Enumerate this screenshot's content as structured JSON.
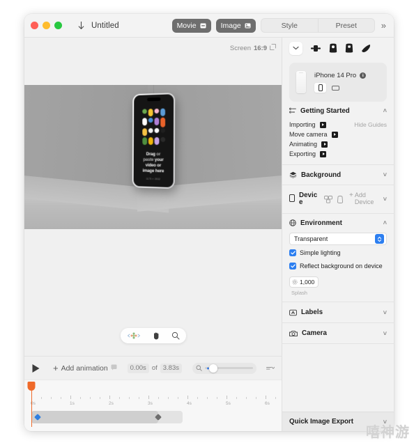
{
  "window": {
    "title": "Untitled",
    "download_icon": "download-arrow-icon",
    "traffic_lights": [
      "close",
      "minimize",
      "zoom"
    ]
  },
  "toolbar": {
    "movie_label": "Movie",
    "image_label": "Image",
    "style_label": "Style",
    "preset_label": "Preset",
    "overflow_label": "»"
  },
  "canvas": {
    "screen_prefix": "Screen",
    "screen_ratio": "16:9",
    "aspect_icon": "aspect-ratio-icon",
    "chevron_icon": "chevron-down-icon",
    "tools": [
      "move-axis-icon",
      "hand-tool-icon",
      "zoom-tool-icon"
    ],
    "phone": {
      "drop_line1_strong": "Drag",
      "drop_line1_dim": " or",
      "drop_line2_dim": "paste ",
      "drop_line2_strong": "your",
      "drop_line3": "video or",
      "drop_line4": "image here",
      "drop_sub": "1170 × 2532",
      "pill_colors": [
        "#6aa84f",
        "#f4c430",
        "#f7b7cf",
        "#5b9bd5",
        "#ffffff",
        "#4a90d9",
        "#b07fd6",
        "#f6c244",
        "#f2b705",
        "#e8e8e8",
        "#f0f0f0",
        "#e8622a",
        "#4f8f3f",
        "#efb40d",
        "#c5a3e8",
        "#2a2a2a"
      ]
    }
  },
  "transport": {
    "play_icon": "play-icon",
    "add_animation_label": "Add animation",
    "add_animation_badge_icon": "hint-badge-icon",
    "current_time": "0.00s",
    "of_label": "of",
    "total_time": "3.83s",
    "zoom_icon": "magnifier-icon",
    "fit_icon": "fit-timeline-icon"
  },
  "timeline": {
    "tick_labels": [
      "0s",
      "1s",
      "2s",
      "3s",
      "4s",
      "5s",
      "6s"
    ],
    "keyframes": [
      {
        "name": "start-keyframe",
        "color": "#2f7fe0"
      },
      {
        "name": "end-keyframe",
        "color": "#6d6d6d"
      }
    ]
  },
  "inspector": {
    "toolbar_icons": [
      "presets-chevron-icon",
      "camera-rig-icon",
      "device-front-icon",
      "device-back-icon",
      "device-angle-icon"
    ],
    "device_card": {
      "name": "iPhone 14 Pro",
      "info_badge": "i",
      "portrait_icon": "portrait-orientation-icon",
      "landscape_icon": "landscape-orientation-icon"
    },
    "sections": {
      "getting_started": {
        "title": "Getting Started",
        "icon": "checklist-icon",
        "caret": "˄",
        "hide_guides_label": "Hide Guides",
        "items": [
          {
            "label": "Importing"
          },
          {
            "label": "Move camera"
          },
          {
            "label": "Animating"
          },
          {
            "label": "Exporting"
          }
        ]
      },
      "background": {
        "title": "Background",
        "icon": "layers-icon",
        "caret": "˅"
      },
      "device": {
        "title": "Device",
        "icon": "phone-icon",
        "duplicate_icon": "duplicate-device-icon",
        "copy_icon": "copy-device-icon",
        "add_plus": "+",
        "add_label": "Add Device",
        "caret": "˅"
      },
      "environment": {
        "title": "Environment",
        "icon": "globe-icon",
        "caret": "˄",
        "preset_value": "Transparent",
        "simple_lighting_label": "Simple lighting",
        "simple_lighting_checked": true,
        "reflect_label": "Reflect background on device",
        "reflect_checked": true,
        "splash_value": "1,000",
        "splash_caption": "Splash",
        "splash_icon": "sun-icon"
      },
      "labels": {
        "title": "Labels",
        "icon": "text-label-icon",
        "caret": "˅"
      },
      "camera": {
        "title": "Camera",
        "icon": "camera-icon",
        "caret": "˅"
      }
    },
    "quick_export": {
      "label": "Quick Image Export",
      "caret": "˅"
    }
  },
  "watermark": {
    "text": "嘻神游"
  },
  "colors": {
    "accent_blue": "#2d7ff0",
    "playhead_orange": "#ef6a2a",
    "pill_dark": "#6e6e6e"
  }
}
